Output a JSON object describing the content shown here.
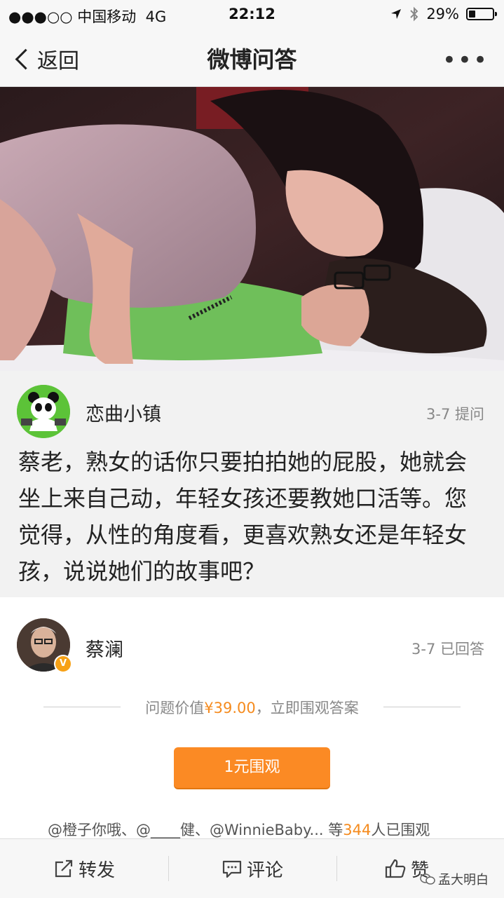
{
  "status_bar": {
    "carrier": "●●●○○ 中国移动",
    "network": "4G",
    "time": "22:12",
    "battery": "29%",
    "battery_level": 0.29
  },
  "nav": {
    "back_label": "返回",
    "title": "微博问答",
    "more_label": "•••"
  },
  "question": {
    "author": "恋曲小镇",
    "meta": "3-7 提问",
    "text": "蔡老，熟女的话你只要拍拍她的屁股，她就会坐上来自己动，年轻女孩还要教她口活等。您觉得，从性的角度看，更喜欢熟女还是年轻女孩，说说她们的故事吧？"
  },
  "answer": {
    "author": "蔡澜",
    "meta": "3-7 已回答",
    "value_prefix": "问题价值",
    "value_price": "¥39.00",
    "value_suffix": "，立即围观答案",
    "pay_button": "1元围观",
    "watchers_prefix": "@橙子你哦、@____健、@WinnieBaby... 等",
    "watchers_count": "344",
    "watchers_suffix": "人已围观"
  },
  "toolbar": {
    "repost": "转发",
    "comment": "评论",
    "like": "赞"
  },
  "watermark": "孟大明白",
  "colors": {
    "accent": "#fb8a24",
    "price": "#f58b1e",
    "verified_badge": "#f7a116"
  }
}
